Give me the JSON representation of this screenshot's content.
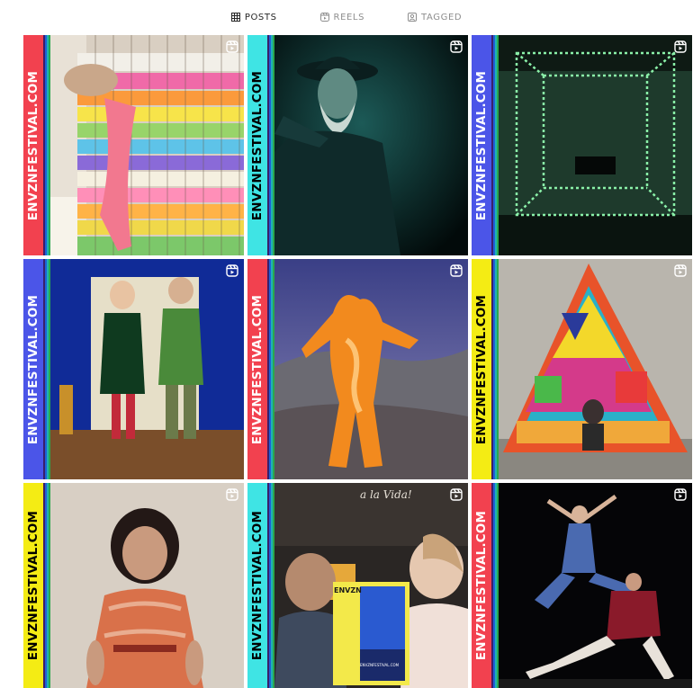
{
  "tabs": [
    {
      "label": "POSTS",
      "icon": "grid-icon",
      "active": true
    },
    {
      "label": "REELS",
      "icon": "reels-icon",
      "active": false
    },
    {
      "label": "TAGGED",
      "icon": "tagged-icon",
      "active": false
    }
  ],
  "posts": [
    {
      "side_text": "ENVZNFESTIVAL.COM",
      "band_color": "#f2414f",
      "text_color": "#ffffff",
      "reel": true
    },
    {
      "side_text": "ENVZNFESTIVAL.COM",
      "band_color": "#3fe4e4",
      "text_color": "#000000",
      "reel": true
    },
    {
      "side_text": "ENVZNFESTIVAL.COM",
      "band_color": "#4b55e8",
      "text_color": "#ffffff",
      "reel": true
    },
    {
      "side_text": "ENVZNFESTIVAL.COM",
      "band_color": "#4b55e8",
      "text_color": "#ffffff",
      "reel": true
    },
    {
      "side_text": "ENVZNFESTIVAL.COM",
      "band_color": "#f2414f",
      "text_color": "#ffffff",
      "reel": true
    },
    {
      "side_text": "ENVZNFESTIVAL.COM",
      "band_color": "#f4ec14",
      "text_color": "#000000",
      "reel": true
    },
    {
      "side_text": "ENVZNFESTIVAL.COM",
      "band_color": "#f4ec14",
      "text_color": "#000000",
      "reel": true
    },
    {
      "side_text": "ENVZNFESTIVAL.COM",
      "band_color": "#3fe4e4",
      "text_color": "#000000",
      "reel": true
    },
    {
      "side_text": "ENVZNFESTIVAL.COM",
      "band_color": "#f2414f",
      "text_color": "#ffffff",
      "reel": true
    }
  ],
  "stripe_colors": [
    "#3a1f6b",
    "#1f5fd6",
    "#1fb0b5",
    "#2aa84f"
  ],
  "poster_text": {
    "logo": "ENVZN",
    "url": "ENVZNFESTIVAL.COM",
    "sign": "a la Vida!"
  }
}
